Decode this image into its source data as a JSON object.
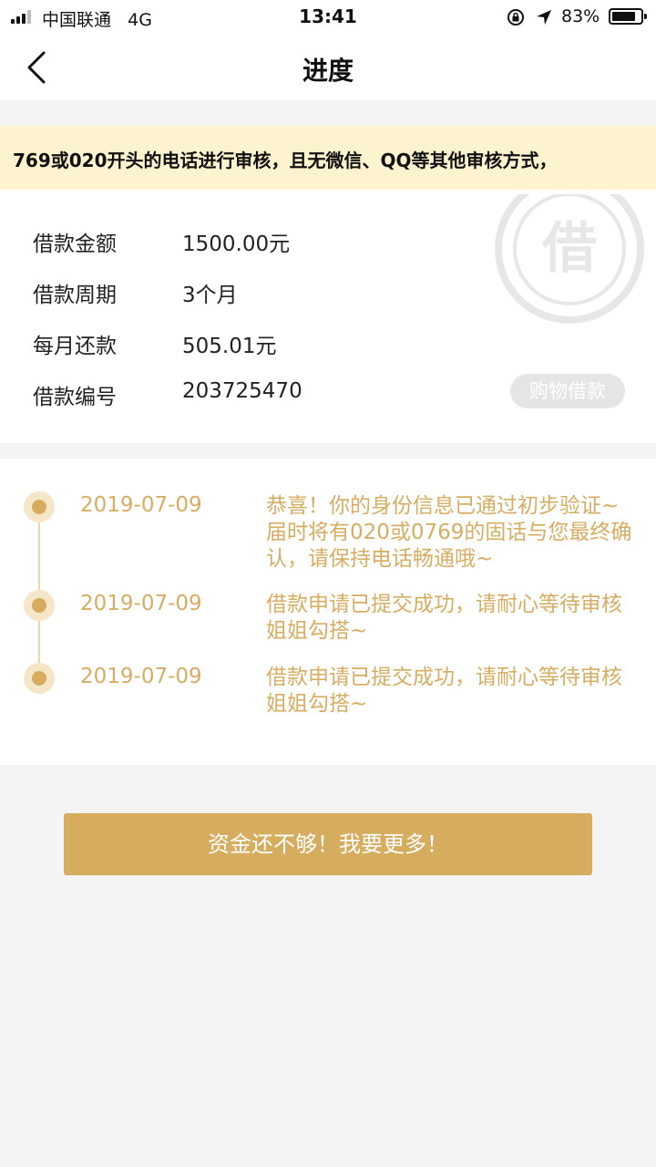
{
  "status_bar": {
    "carrier": "中国联通",
    "network": "4G",
    "time": "13:41",
    "battery": "83%",
    "battery_level": 0.83
  },
  "nav": {
    "title": "进度",
    "back_icon": "chevron-left-icon"
  },
  "notice": {
    "text": "769或020开头的电话进行审核，且无微信、QQ等其他审核方式，"
  },
  "loan": {
    "seal_text": "借",
    "rows": [
      {
        "label": "借款金额",
        "value": "1500.00元"
      },
      {
        "label": "借款周期",
        "value": "3个月"
      },
      {
        "label": "每月还款",
        "value": "505.01元"
      },
      {
        "label": "借款编号",
        "value": "203725470"
      }
    ],
    "tag": "购物借款"
  },
  "timeline": [
    {
      "date": "2019-07-09",
      "text": "恭喜！你的身份信息已通过初步验证~届时将有020或0769的固话与您最终确认，请保持电话畅通哦~"
    },
    {
      "date": "2019-07-09",
      "text": "借款申请已提交成功，请耐心等待审核姐姐勾搭~"
    },
    {
      "date": "2019-07-09",
      "text": "借款申请已提交成功，请耐心等待审核姐姐勾搭~"
    }
  ],
  "action": {
    "button_label": "资金还不够！我要更多！"
  },
  "colors": {
    "accent": "#d6ad5f",
    "notice_bg": "#fdf3cf",
    "timeline_text": "#d6ad62",
    "page_bg": "#f4f4f4"
  }
}
